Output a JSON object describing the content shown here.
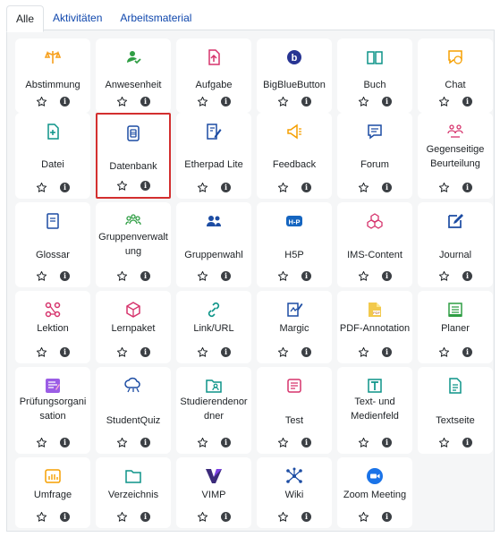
{
  "tabs": [
    "Alle",
    "Aktivitäten",
    "Arbeitsmaterial"
  ],
  "active_tab": "Alle",
  "info_glyph": "i",
  "modules": [
    {
      "label": "Abstimmung",
      "icon": "choice-icon",
      "color": "#f7a01d"
    },
    {
      "label": "Anwesenheit",
      "icon": "attendance-icon",
      "color": "#2f9e44"
    },
    {
      "label": "Aufgabe",
      "icon": "assignment-icon",
      "color": "#d6336c"
    },
    {
      "label": "BigBlueButton",
      "icon": "bigbluebutton-icon",
      "color": "#283593"
    },
    {
      "label": "Buch",
      "icon": "book-icon",
      "color": "#0d9488"
    },
    {
      "label": "Chat",
      "icon": "chat-icon",
      "color": "#f59f00"
    },
    {
      "label": "Datei",
      "icon": "file-icon",
      "color": "#0d9488"
    },
    {
      "label": "Datenbank",
      "icon": "database-icon",
      "color": "#1c4ca3",
      "highlight": true
    },
    {
      "label": "Etherpad Lite",
      "icon": "etherpad-icon",
      "color": "#1c4ca3"
    },
    {
      "label": "Feedback",
      "icon": "feedback-icon",
      "color": "#f59f00"
    },
    {
      "label": "Forum",
      "icon": "forum-icon",
      "color": "#1c4ca3"
    },
    {
      "label": "Gegenseitige Beurteilung",
      "icon": "workshop-icon",
      "color": "#d6336c"
    },
    {
      "label": "Glossar",
      "icon": "glossary-icon",
      "color": "#1c4ca3"
    },
    {
      "label": "Gruppenverwaltung",
      "icon": "group-management-icon",
      "color": "#2f9e44"
    },
    {
      "label": "Gruppenwahl",
      "icon": "group-choice-icon",
      "color": "#1c4ca3"
    },
    {
      "label": "H5P",
      "icon": "h5p-icon",
      "color": "#1565c0"
    },
    {
      "label": "IMS-Content",
      "icon": "ims-content-icon",
      "color": "#d6336c"
    },
    {
      "label": "Journal",
      "icon": "journal-icon",
      "color": "#1c4ca3"
    },
    {
      "label": "Lektion",
      "icon": "lesson-icon",
      "color": "#d6336c"
    },
    {
      "label": "Lernpaket",
      "icon": "scorm-package-icon",
      "color": "#d6336c"
    },
    {
      "label": "Link/URL",
      "icon": "link-icon",
      "color": "#0d9488"
    },
    {
      "label": "Margic",
      "icon": "margic-icon",
      "color": "#1c4ca3"
    },
    {
      "label": "PDF-Annotation",
      "icon": "pdf-annotation-icon",
      "color": "#f2c94c"
    },
    {
      "label": "Planer",
      "icon": "planner-icon",
      "color": "#2f9e44"
    },
    {
      "label": "Prüfungsorganisation",
      "icon": "exam-organization-icon",
      "color": "#9b5de5"
    },
    {
      "label": "StudentQuiz",
      "icon": "studentquiz-icon",
      "color": "#1c4ca3"
    },
    {
      "label": "Studierendenordner",
      "icon": "student-folder-icon",
      "color": "#0d9488"
    },
    {
      "label": "Test",
      "icon": "quiz-icon",
      "color": "#d6336c"
    },
    {
      "label": "Text- und Medienfeld",
      "icon": "text-media-icon",
      "color": "#0d9488"
    },
    {
      "label": "Textseite",
      "icon": "page-icon",
      "color": "#0d9488"
    },
    {
      "label": "Umfrage",
      "icon": "survey-icon",
      "color": "#f59f00"
    },
    {
      "label": "Verzeichnis",
      "icon": "folder-icon",
      "color": "#0d9488"
    },
    {
      "label": "VIMP",
      "icon": "vimp-icon",
      "color": "#3b2a7a"
    },
    {
      "label": "Wiki",
      "icon": "wiki-icon",
      "color": "#1c4ca3"
    },
    {
      "label": "Zoom Meeting",
      "icon": "zoom-icon",
      "color": "#1a73e8"
    }
  ]
}
